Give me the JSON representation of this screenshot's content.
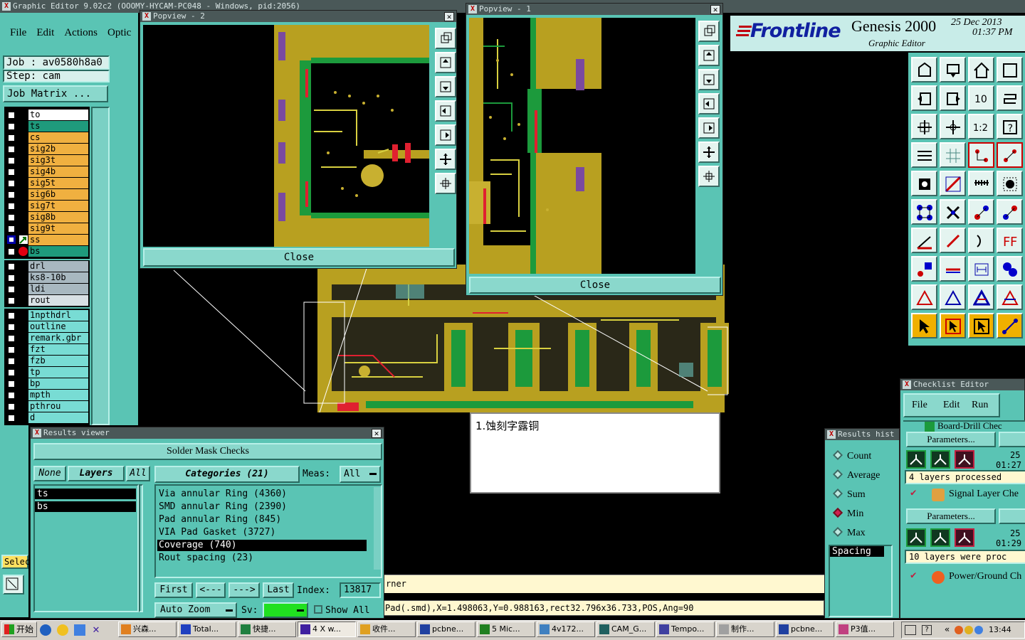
{
  "app": {
    "window_title": "Graphic Editor 9.02c2  (OOOMY-HYCAM-PC048 - Windows, pid:2056)",
    "menu": [
      "File",
      "Edit",
      "Actions",
      "Optic"
    ],
    "job_label": "Job : av0580h8a0",
    "step_label": "Step: cam",
    "job_matrix_button": "Job Matrix ...",
    "select_label": "Selec"
  },
  "brand": {
    "logo": "Frontline",
    "product": "Genesis 2000",
    "subtitle": "Graphic Editor",
    "date": "25 Dec 2013",
    "time": "01:37 PM"
  },
  "layers_board": [
    {
      "name": "to",
      "color": "#ffffff"
    },
    {
      "name": "ts",
      "color": "#1f9a7c"
    },
    {
      "name": "cs",
      "color": "#f0b040"
    },
    {
      "name": "sig2b",
      "color": "#f0b040"
    },
    {
      "name": "sig3t",
      "color": "#f0b040"
    },
    {
      "name": "sig4b",
      "color": "#f0b040"
    },
    {
      "name": "sig5t",
      "color": "#f0b040"
    },
    {
      "name": "sig6b",
      "color": "#f0b040"
    },
    {
      "name": "sig7t",
      "color": "#f0b040"
    },
    {
      "name": "sig8b",
      "color": "#f0b040"
    },
    {
      "name": "sig9t",
      "color": "#f0b040"
    },
    {
      "name": "ss",
      "color": "#f0b040"
    },
    {
      "name": "bs",
      "color": "#1f9a7c"
    }
  ],
  "layers_drill": [
    {
      "name": "drl",
      "color": "#a8b8c0"
    },
    {
      "name": "ks8-10b",
      "color": "#a8b8c0"
    },
    {
      "name": "ldi",
      "color": "#a8b8c0"
    },
    {
      "name": "rout",
      "color": "#d8e0e4"
    }
  ],
  "layers_misc": [
    {
      "name": "1npthdrl",
      "color": "#78dcd4"
    },
    {
      "name": "outline",
      "color": "#78dcd4"
    },
    {
      "name": "remark.gbr",
      "color": "#78dcd4"
    },
    {
      "name": "fzt",
      "color": "#78dcd4"
    },
    {
      "name": "fzb",
      "color": "#78dcd4"
    },
    {
      "name": "tp",
      "color": "#78dcd4"
    },
    {
      "name": "bp",
      "color": "#78dcd4"
    },
    {
      "name": "mpth",
      "color": "#78dcd4"
    },
    {
      "name": "pthrou",
      "color": "#78dcd4"
    },
    {
      "name": "d",
      "color": "#78dcd4"
    }
  ],
  "popview2": {
    "title": "Popview - 2",
    "close": "Close"
  },
  "popview1": {
    "title": "Popview - 1",
    "close": "Close"
  },
  "results": {
    "title": "Results viewer",
    "header": "Solder Mask Checks",
    "none": "None",
    "layers": "Layers",
    "all": "All",
    "categories": "Categories (21)",
    "meas_label": "Meas:",
    "meas_value": "All",
    "layer_items": [
      "ts",
      "bs"
    ],
    "category_items": [
      "Via annular Ring (4360)",
      "SMD annular Ring (2390)",
      "Pad annular Ring (845)",
      "VIA Pad Gasket (3727)",
      "Coverage (740)",
      "Rout spacing (23)"
    ],
    "selected_category": 4,
    "first": "First",
    "prev": "<---",
    "next": "--->",
    "last": "Last",
    "index_label": "Index:",
    "index_value": "13817",
    "auto_zoom": "Auto Zoom",
    "sv_label": "Sv:",
    "show_all": "Show All"
  },
  "note": {
    "text": "1.蚀刻字露铜"
  },
  "status": {
    "line1": "rner",
    "line2": "Pad(.smd),X=1.498063,Y=0.988163,rect32.796x36.733,POS,Ang=90"
  },
  "results_hist": {
    "title": "Results hist",
    "options": [
      "Count",
      "Average",
      "Sum",
      "Min",
      "Max"
    ],
    "selected": "Min",
    "list_item": "Spacing"
  },
  "checklist": {
    "title": "Checklist Editor",
    "menu": [
      "File",
      "Edit",
      "Run"
    ],
    "item0": "Board-Drill Chec",
    "params": "Parameters...",
    "num": "25",
    "time1": "01:27",
    "msg1": "4 layers processed",
    "item1": "Signal Layer Che",
    "time2": "01:29",
    "msg2": "10 layers were proc",
    "item2": "Power/Ground Ch"
  },
  "taskbar": {
    "start": "开始",
    "tasks": [
      "兴森...",
      "Total...",
      "快捷...",
      "4 X w...",
      "收件...",
      "pcbne...",
      "5 Mic...",
      "4v172...",
      "CAM_G...",
      "Tempo...",
      "制作...",
      "pcbne...",
      "P3值..."
    ],
    "clock": "13:44"
  },
  "colors": {
    "teal": "#5ac4b4",
    "copper": "#b8a020",
    "mask_green": "#1c9a3c",
    "trace_red": "#e02030"
  }
}
